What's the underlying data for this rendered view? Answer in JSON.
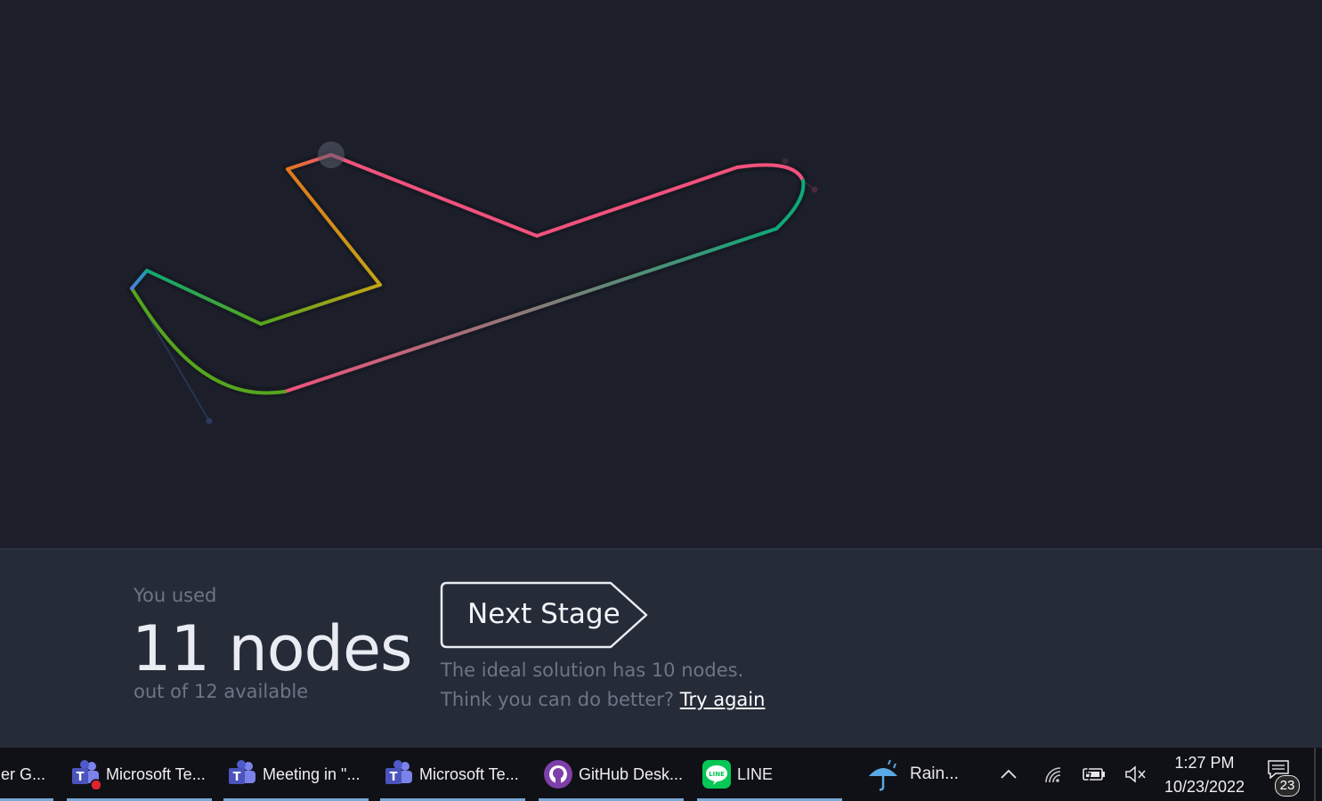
{
  "game": {
    "used_label": "You used",
    "nodes_count": "11 nodes",
    "available_label": "out of 12 available",
    "next_stage_label": "Next Stage",
    "ideal_text": "The ideal solution has 10 nodes. Think you can do better?",
    "try_again_label": "Try again"
  },
  "taskbar": {
    "items": [
      {
        "label": "tier G...",
        "icon": "app-icon"
      },
      {
        "label": "Microsoft Te...",
        "icon": "teams-icon"
      },
      {
        "label": "Meeting in \"...",
        "icon": "teams-icon"
      },
      {
        "label": "Microsoft Te...",
        "icon": "teams-icon"
      },
      {
        "label": "GitHub Desk...",
        "icon": "github-icon"
      },
      {
        "label": "LINE",
        "icon": "line-icon"
      }
    ],
    "weather_label": "Rain...",
    "time": "1:27 PM",
    "date": "10/23/2022",
    "notification_count": "23"
  },
  "colors": {
    "background": "#1c1f2a",
    "panel": "#262b38",
    "path_pink": "#f2527d",
    "path_orange": "#e0781e",
    "path_yellow": "#c3a317",
    "path_green": "#56a51d",
    "path_teal": "#0fa878",
    "path_blue": "#4f7ee0"
  }
}
